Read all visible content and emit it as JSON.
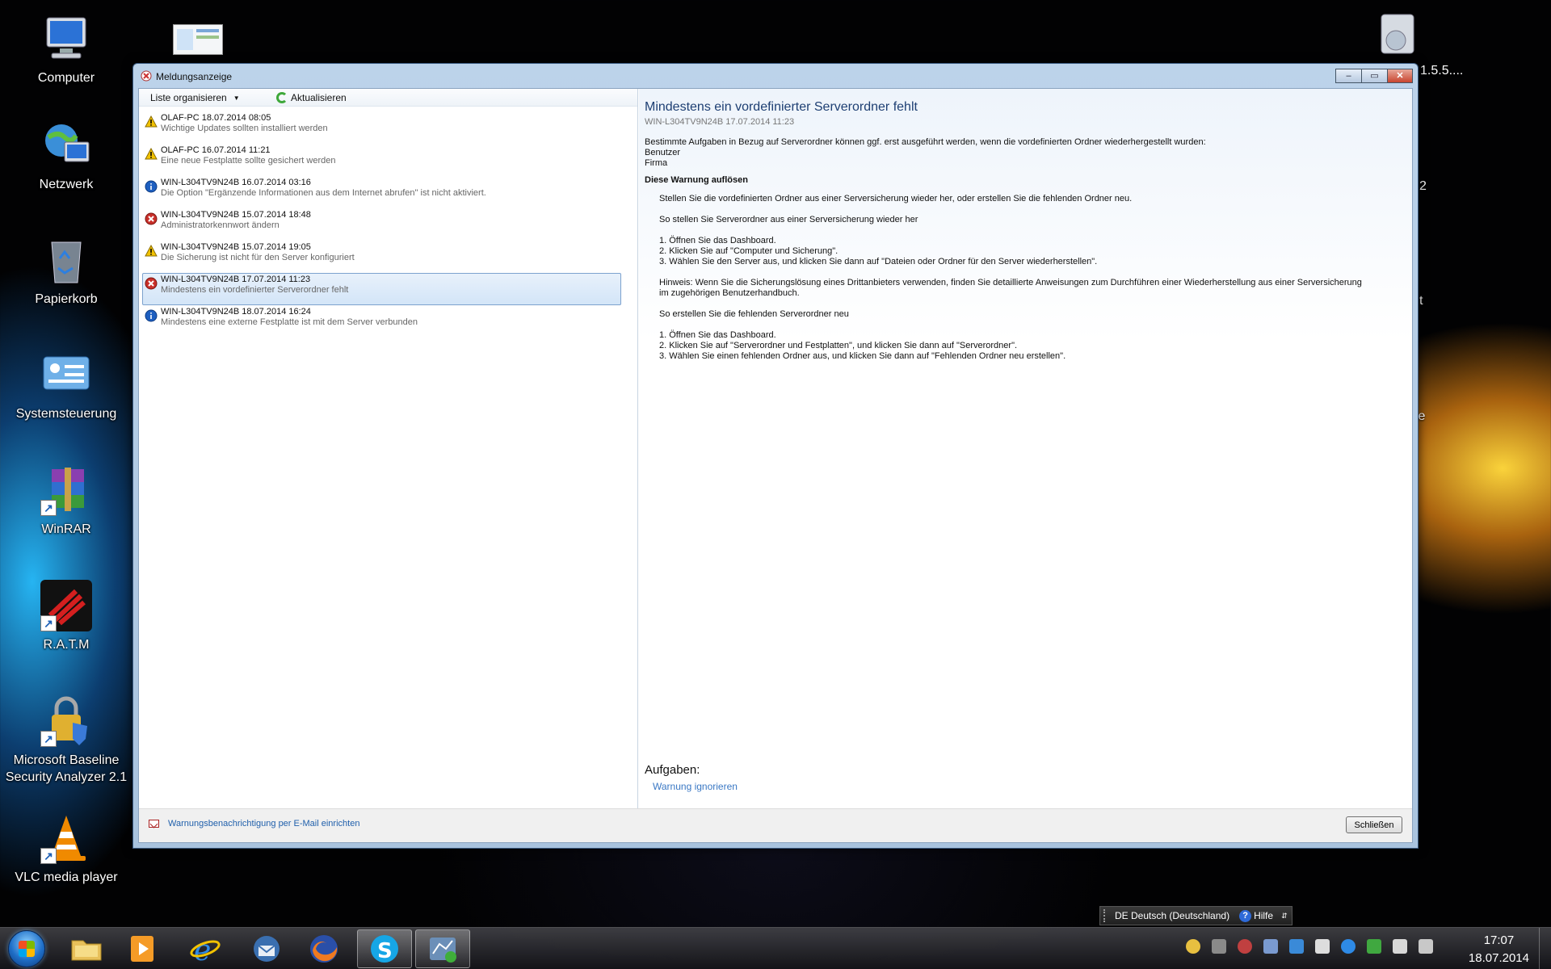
{
  "desktop": {
    "icons": [
      {
        "label": "Computer"
      },
      {
        "label": "Netzwerk"
      },
      {
        "label": "Papierkorb"
      },
      {
        "label": "Systemsteuerung"
      },
      {
        "label": "WinRAR"
      },
      {
        "label": "R.A.T.M"
      },
      {
        "label": "Microsoft Baseline\nSecurity Analyzer 2.1"
      },
      {
        "label": "VLC media player"
      }
    ],
    "partial_labels": [
      "1.5.5....",
      "2",
      "t",
      "ie"
    ]
  },
  "window": {
    "title": "Meldungsanzeige",
    "toolbar": {
      "organize_label": "Liste organisieren",
      "refresh_label": "Aktualisieren"
    },
    "messages": [
      {
        "severity": "warning",
        "line1": "OLAF-PC 18.07.2014 08:05",
        "line2": "Wichtige Updates sollten installiert werden"
      },
      {
        "severity": "warning",
        "line1": "OLAF-PC 16.07.2014 11:21",
        "line2": "Eine neue Festplatte sollte gesichert werden"
      },
      {
        "severity": "info",
        "line1": "WIN-L304TV9N24B 16.07.2014 03:16",
        "line2": "Die Option \"Ergänzende Informationen aus dem Internet abrufen\" ist nicht aktiviert."
      },
      {
        "severity": "error",
        "line1": "WIN-L304TV9N24B 15.07.2014 18:48",
        "line2": "Administratorkennwort ändern"
      },
      {
        "severity": "warning",
        "line1": "WIN-L304TV9N24B 15.07.2014 19:05",
        "line2": "Die Sicherung ist nicht für den Server konfiguriert"
      },
      {
        "severity": "error",
        "line1": "WIN-L304TV9N24B 17.07.2014 11:23",
        "line2": "Mindestens ein vordefinierter Serverordner fehlt",
        "selected": true
      },
      {
        "severity": "info",
        "line1": "WIN-L304TV9N24B 18.07.2014 16:24",
        "line2": "Mindestens eine externe Festplatte ist mit dem Server verbunden"
      }
    ],
    "detail": {
      "title": "Mindestens ein vordefinierter Serverordner fehlt",
      "subtitle": "WIN-L304TV9N24B 17.07.2014 11:23",
      "intro": "Bestimmte Aufgaben in Bezug auf Serverordner können ggf. erst ausgeführt werden, wenn die vordefinierten Ordner wiederhergestellt wurden:",
      "folders": [
        "Benutzer",
        "Firma"
      ],
      "resolve_heading": "Diese Warnung auflösen",
      "resolve_text": "Stellen Sie die vordefinierten Ordner aus einer Serversicherung wieder her, oder erstellen Sie die fehlenden Ordner neu.",
      "restore_heading": "So stellen Sie Serverordner aus einer Serversicherung wieder her",
      "restore_steps": [
        "1. Öffnen Sie das Dashboard.",
        "2. Klicken Sie auf \"Computer und Sicherung\".",
        "3. Wählen Sie den Server aus, und klicken Sie dann auf \"Dateien oder Ordner für den Server wiederherstellen\"."
      ],
      "hint": "Hinweis: Wenn Sie die Sicherungslösung eines Drittanbieters verwenden, finden Sie detaillierte Anweisungen zum Durchführen einer Wiederherstellung aus einer Serversicherung im zugehörigen Benutzerhandbuch.",
      "recreate_heading": "So erstellen Sie die fehlenden Serverordner neu",
      "recreate_steps": [
        "1. Öffnen Sie das Dashboard.",
        "2. Klicken Sie auf \"Serverordner und Festplatten\", und klicken Sie dann auf \"Serverordner\".",
        "3. Wählen Sie einen fehlenden Ordner aus, und klicken Sie dann auf \"Fehlenden Ordner neu erstellen\"."
      ],
      "tasks_heading": "Aufgaben:",
      "task_ignore": "Warnung ignorieren"
    },
    "email_link": "Warnungsbenachrichtigung per E-Mail einrichten",
    "close_button": "Schließen"
  },
  "langbar": {
    "language": "DE Deutsch (Deutschland)",
    "help": "Hilfe"
  },
  "taskbar": {
    "time": "17:07",
    "date": "18.07.2014"
  },
  "colors": {
    "warning": "#f2c200",
    "error": "#c8302a",
    "info": "#1e5fc0",
    "link": "#1f5fab"
  }
}
